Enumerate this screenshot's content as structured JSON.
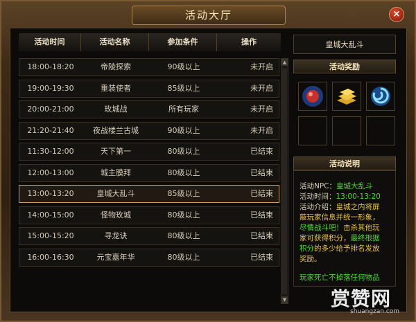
{
  "window": {
    "title": "活动大厅",
    "close": "×"
  },
  "table": {
    "headers": [
      "活动时间",
      "活动名称",
      "参加条件",
      "操作"
    ],
    "rows": [
      {
        "time": "18:00-18:20",
        "name": "帝陵探索",
        "req": "90级以上",
        "status": "未开启"
      },
      {
        "time": "19:00-19:30",
        "name": "重装使者",
        "req": "85级以上",
        "status": "未开启"
      },
      {
        "time": "20:00-21:00",
        "name": "玫城战",
        "req": "所有玩家",
        "status": "未开启"
      },
      {
        "time": "21:20-21:40",
        "name": "夜战楼兰古城",
        "req": "90级以上",
        "status": "未开启"
      },
      {
        "time": "11:30-12:00",
        "name": "天下第一",
        "req": "80级以上",
        "status": "已结束"
      },
      {
        "time": "12:00-13:00",
        "name": "城主膜拜",
        "req": "80级以上",
        "status": "已结束"
      },
      {
        "time": "13:00-13:20",
        "name": "皇城大乱斗",
        "req": "85级以上",
        "status": "已结束"
      },
      {
        "time": "14:00-15:00",
        "name": "怪物玫城",
        "req": "80级以上",
        "status": "已结束"
      },
      {
        "time": "15:00-15:20",
        "name": "寻龙诀",
        "req": "80级以上",
        "status": "已结束"
      },
      {
        "time": "16:00-16:30",
        "name": "元宝嘉年华",
        "req": "80级以上",
        "status": "已结束"
      }
    ]
  },
  "detail": {
    "npc_title": "皇城大乱斗",
    "rewards_header": "活动奖励",
    "desc_header": "活动说明",
    "npc_label": "活动NPC：",
    "npc_value": "皇城大乱斗",
    "time_label": "活动时间：",
    "time_value": "13:00-13:20",
    "intro_label": "活动介绍：",
    "intro_1": "皇城之内将屏",
    "intro_2": "蔽玩家信息并统一形象，",
    "intro_3": "尽情战斗吧！",
    "intro_4": "击杀其他玩",
    "intro_5": "家可获得积分，",
    "intro_6": "最终根据",
    "intro_7": "积分",
    "intro_8": "的多少给予排名发放",
    "intro_9": "奖励。",
    "death_note": "玩家死亡不掉落任何物品"
  },
  "watermark": {
    "brand": "赏赞网",
    "url": "shuangzan.com"
  },
  "colors": {
    "green": "#52d63a",
    "yellow": "#e8c04a",
    "gold_border": "#c9a45a"
  },
  "reward_icons": [
    "red-orb-icon",
    "gold-bars-icon",
    "blue-swirl-icon"
  ]
}
